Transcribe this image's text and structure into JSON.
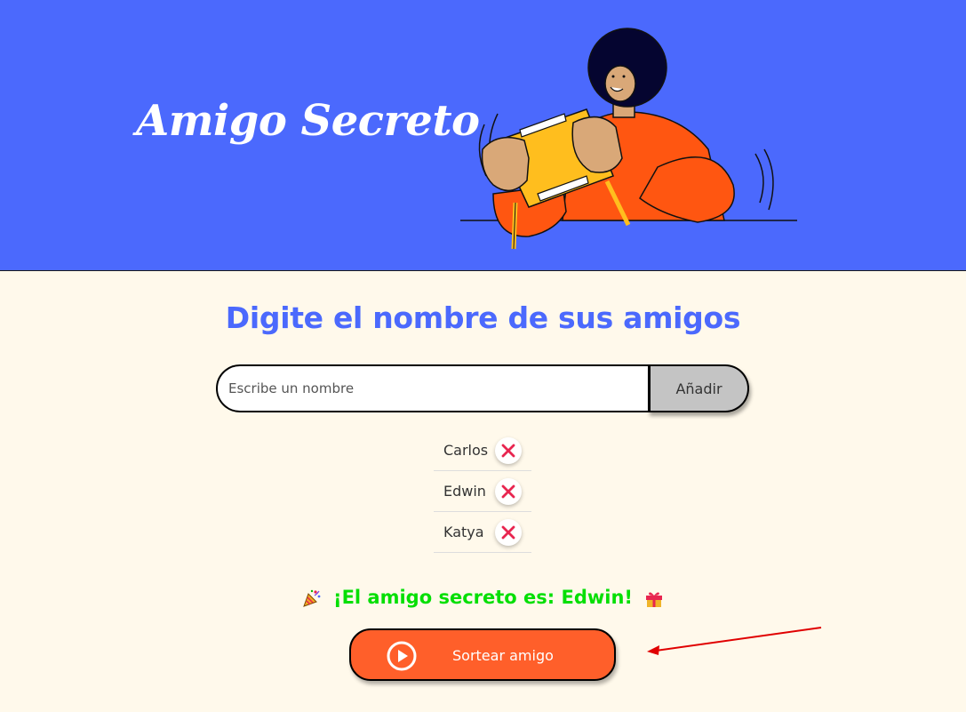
{
  "header": {
    "title": "Amigo Secreto"
  },
  "main": {
    "heading": "Digite el nombre de sus amigos",
    "input": {
      "placeholder": "Escribe un nombre",
      "value": ""
    },
    "add_button_label": "Añadir",
    "friends": [
      {
        "name": "Carlos"
      },
      {
        "name": "Edwin"
      },
      {
        "name": "Katya"
      }
    ],
    "result_text": "¡El amigo secreto es: Edwin!",
    "result_icons": [
      "party-popper-icon",
      "gift-icon"
    ],
    "draw_button_label": "Sortear amigo"
  },
  "colors": {
    "header_bg": "#4b69fd",
    "page_bg": "#fff9eb",
    "heading": "#4b69fd",
    "result": "#05df05",
    "draw_button": "#ff5f2a",
    "add_button": "#c4c4c4",
    "remove_icon": "#e8254f",
    "annotation_arrow": "#e00000"
  }
}
